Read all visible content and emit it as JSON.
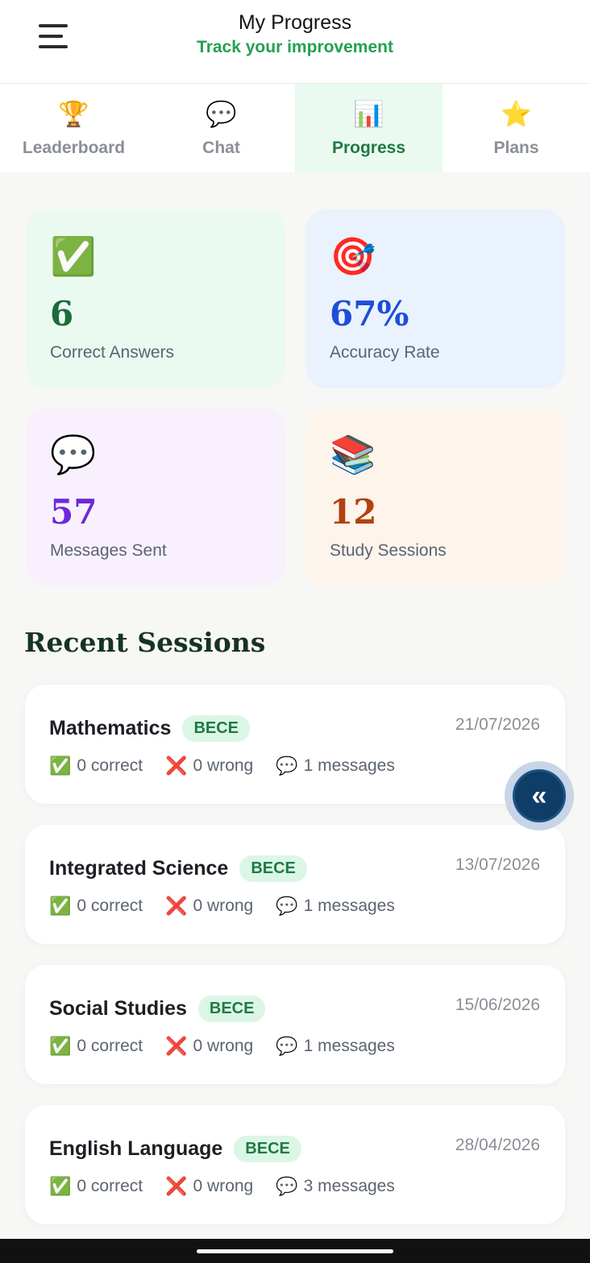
{
  "header": {
    "title": "My Progress",
    "subtitle": "Track your improvement",
    "menu_icon": "hamburger-menu-icon"
  },
  "tabs": [
    {
      "label": "Leaderboard",
      "icon": "🏆",
      "icon_name": "trophy-icon",
      "active": false
    },
    {
      "label": "Chat",
      "icon": "💬",
      "icon_name": "speech-bubble-icon",
      "active": false
    },
    {
      "label": "Progress",
      "icon": "📊",
      "icon_name": "bar-chart-icon",
      "active": true
    },
    {
      "label": "Plans",
      "icon": "⭐",
      "icon_name": "star-icon",
      "active": false
    }
  ],
  "stats": [
    {
      "icon": "✅",
      "value": "6",
      "label": "Correct Answers",
      "color": "#1e6b3a",
      "bg": "#eafaf0"
    },
    {
      "icon": "🎯",
      "value": "67%",
      "label": "Accuracy Rate",
      "color": "#1d4ed8",
      "bg": "#eaf2fd"
    },
    {
      "icon": "💬",
      "value": "57",
      "label": "Messages Sent",
      "color": "#6d28d9",
      "bg": "#f8f1fd"
    },
    {
      "icon": "📚",
      "value": "12",
      "label": "Study Sessions",
      "color": "#b3410f",
      "bg": "#fdf4eb"
    }
  ],
  "recent": {
    "title": "Recent Sessions",
    "sessions": [
      {
        "subject": "Mathematics",
        "badge": "BECE",
        "date": "21/07/2026",
        "correct": "0 correct",
        "wrong": "0 wrong",
        "messages": "1 messages"
      },
      {
        "subject": "Integrated Science",
        "badge": "BECE",
        "date": "13/07/2026",
        "correct": "0 correct",
        "wrong": "0 wrong",
        "messages": "1 messages"
      },
      {
        "subject": "Social Studies",
        "badge": "BECE",
        "date": "15/06/2026",
        "correct": "0 correct",
        "wrong": "0 wrong",
        "messages": "1 messages"
      },
      {
        "subject": "English Language",
        "badge": "BECE",
        "date": "28/04/2026",
        "correct": "0 correct",
        "wrong": "0 wrong",
        "messages": "3 messages"
      }
    ],
    "icons": {
      "correct": "✅",
      "wrong": "❌",
      "messages": "💬"
    }
  },
  "fab": {
    "icon": "«",
    "icon_name": "double-chevron-left-icon"
  },
  "colors": {
    "accent": "#22a150",
    "accent_dark": "#1f7a43",
    "fab": "#0e3d68"
  }
}
